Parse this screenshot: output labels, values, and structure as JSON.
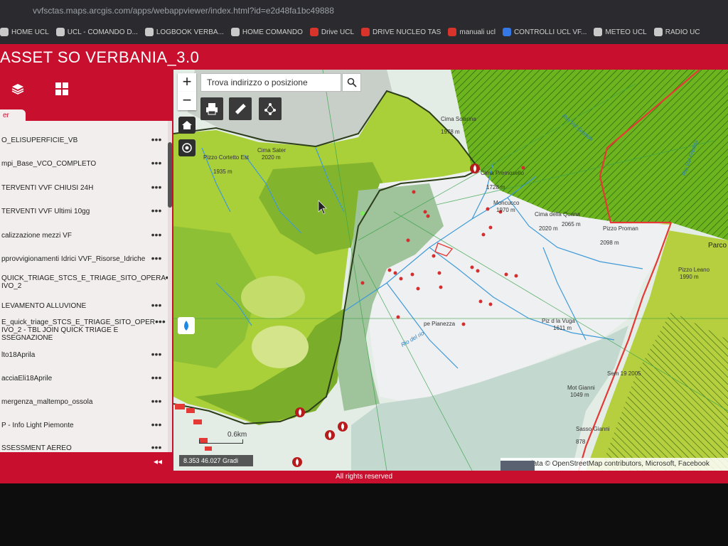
{
  "browser": {
    "url": "vvfsctas.maps.arcgis.com/apps/webappviewer/index.html?id=e2d48fa1bc49888",
    "bookmarks": [
      "HOME UCL",
      "UCL - COMANDO D...",
      "LOGBOOK VERBA...",
      "HOME COMANDO",
      "Drive UCL",
      "DRIVE NUCLEO TAS",
      "manuali ucl",
      "CONTROLLI UCL VF...",
      "METEO UCL",
      "RADIO UC"
    ]
  },
  "app": {
    "title": "ASSET SO VERBANIA_3.0"
  },
  "sidebar": {
    "tab_label": "er",
    "layers": [
      "O_ELISUPERFICIE_VB",
      "mpi_Base_VCO_COMPLETO",
      "TERVENTI VVF CHIUSI 24H",
      "TERVENTI VVF Ultimi 10gg",
      "calizzazione mezzi VF",
      "pprovvigionamenti Idrici VVF_Risorse_Idriche",
      "QUICK_TRIAGE_STCS_E_TRIAGE_SITO_OPERA IVO_2",
      "LEVAMENTO ALLUVIONE",
      "E_quick_triage_STCS_E_TRIAGE_SITO_OPER IVO_2 - TBL JOIN QUICK TRIAGE E SSEGNAZIONE",
      "lto18Aprila",
      "acciaEli18Aprile",
      "mergenza_maltempo_ossola",
      "P - Info Light Piemonte",
      "SSESSMENT AEREO"
    ],
    "dots": "•••",
    "collapse_label": "◂◂"
  },
  "map": {
    "search_placeholder": "Trova indirizzo o posizione",
    "zoom_in": "+",
    "zoom_out": "−",
    "scale_text": "0.6km",
    "coords_text": "8.353 46.027 Gradi",
    "attribution": "Map data © OpenStreetMap contributors, Microsoft, Facebook",
    "labels": {
      "cima_sciarina": "Cima Sciarina",
      "elev_1978": "1978 m",
      "pizzo_cortetto": "Pizzo Cortetto Est",
      "elev_1935": "1935 m",
      "cima_sater": "Cima Sater",
      "elev_2020a": "2020 m",
      "cima_premosello": "Cima Premosello",
      "elev_1728": "1728 m",
      "moncucco": "Moncucco",
      "elev_1970": "1970 m",
      "cima_quana": "Cima della Quana",
      "elev_2020b": "2020 m",
      "elev_2065": "2065 m",
      "pizzo_proman": "Pizzo Proman",
      "elev_2098": "2098 m",
      "pizzo_leano": "Pizzo Leano",
      "elev_1990": "1990 m",
      "parco": "Parco",
      "pe_pianezza": "pe Pianezza",
      "piz_vuga": "Piz d la Vuga",
      "elev_1611": "1611 m",
      "mot_gianni": "Mot Gianni",
      "elev_1049": "1049 m",
      "sasso": "Sasso Gianni",
      "elev_878": "878",
      "rio_val_grande": "Rio Val Grande",
      "rio_val_fredda": "Rio Val Fredda",
      "rio_del_rio": "Rio del rio",
      "elev_2025": "Sem 19 2005"
    }
  },
  "footer": {
    "text": "All rights reserved"
  },
  "colors": {
    "brand": "#c8102e",
    "header_text": "#ffffff"
  }
}
